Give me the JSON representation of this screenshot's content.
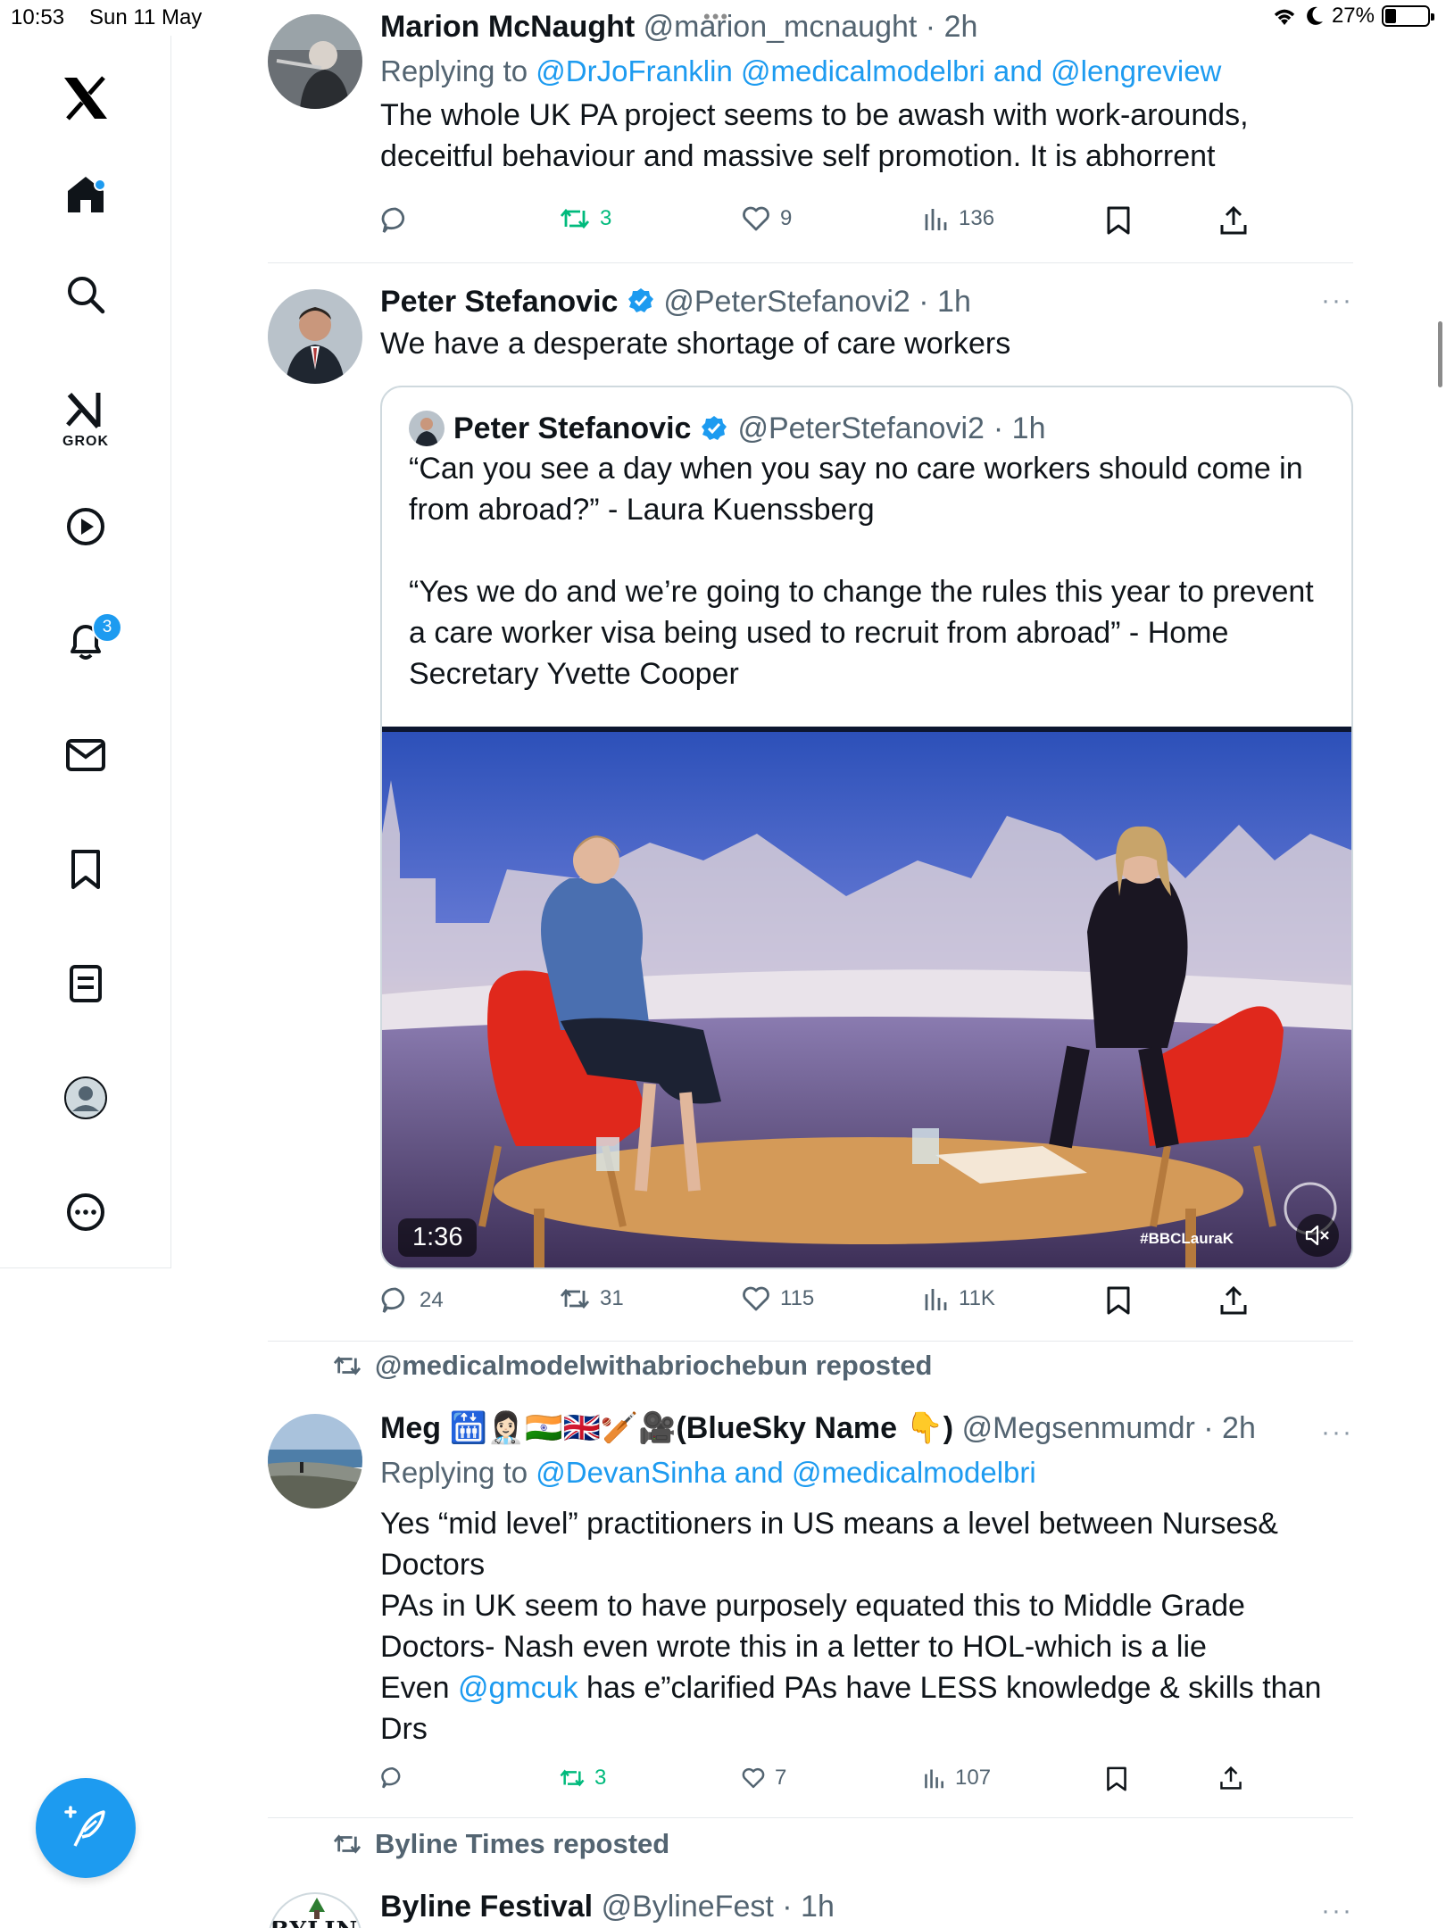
{
  "status_bar": {
    "time": "10:53",
    "date": "Sun 11 May",
    "battery": "27%"
  },
  "sidebar": {
    "grok_label": "GROK",
    "notifications_badge": "3"
  },
  "posts": [
    {
      "name": "Marion McNaught",
      "handle": "@marion_mcnaught",
      "time": "· 2h",
      "replying_prefix": "Replying to ",
      "replying_to": "@DrJoFranklin @medicalmodelbri and @lengreview",
      "text": "The whole UK PA project seems to be awash with work-arounds, deceitful behaviour and massive self promotion. It is abhorrent",
      "replies": "",
      "reposts": "3",
      "likes": "9",
      "views": "136"
    },
    {
      "name": "Peter Stefanovic",
      "handle": "@PeterStefanovi2",
      "time": "· 1h",
      "text": "We have a desperate shortage of care workers",
      "quote": {
        "name": "Peter Stefanovic",
        "handle": "@PeterStefanovi2",
        "time": "· 1h",
        "text_1": "“Can you see a day when you say no care workers should come in from abroad?” - Laura Kuenssberg",
        "text_2": "“Yes we do and we’re going to change the rules this year to prevent a care worker visa being used to recruit from abroad” - Home Secretary Yvette Cooper",
        "video_duration": "1:36",
        "video_watermark": "#BBCLauraK"
      },
      "replies": "24",
      "reposts": "31",
      "likes": "115",
      "views": "11K"
    },
    {
      "reposted_by": "@medicalmodelwithabriochebun reposted",
      "name": "Meg 🛗👩🏻‍⚕️🇮🇳🇬🇧🏏🎥(BlueSky Name 👇)",
      "handle": "@Megsenmumdr",
      "time": "· 2h",
      "replying_prefix": "Replying to ",
      "replying_to": "@DevanSinha and @medicalmodelbri",
      "text_1": "Yes “mid level” practitioners in US means a level between Nurses& Doctors",
      "text_2": "PAs in UK seem to have purposely equated this to Middle Grade Doctors- Nash even wrote this in a letter to HOL-which is a lie",
      "text_3_before": "Even ",
      "text_3_mention": "@gmcuk",
      "text_3_after": " has e”clarified PAs have LESS knowledge & skills than Drs",
      "replies": "",
      "reposts": "3",
      "likes": "7",
      "views": "107"
    },
    {
      "reposted_by": "Byline Times reposted",
      "name": "Byline Festival",
      "handle": "@BylineFest",
      "time": "· 1h",
      "avatar_text": "BYLINE"
    }
  ],
  "colors": {
    "accent": "#1d9bf0",
    "repost_green": "#00ba7c",
    "muted_text": "#536471",
    "divider": "#e6e9ec"
  }
}
